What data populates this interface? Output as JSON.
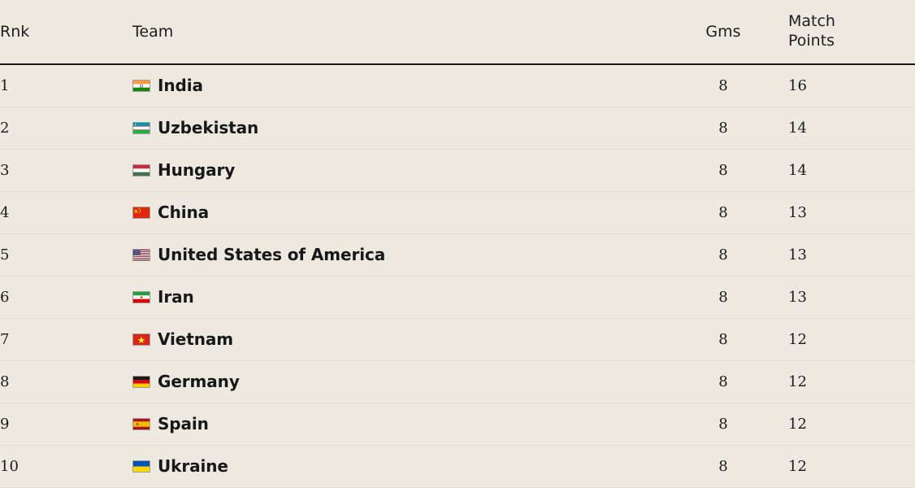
{
  "table": {
    "columns": [
      {
        "key": "rank",
        "label": "Rnk"
      },
      {
        "key": "team",
        "label": "Team"
      },
      {
        "key": "games",
        "label": "Gms"
      },
      {
        "key": "match_points",
        "label": "Match Points"
      }
    ],
    "header": {
      "rnk": "Rnk",
      "team": "Team",
      "gms": "Gms",
      "match_points_line1": "Match",
      "match_points_line2": "Points"
    },
    "rows": [
      {
        "rank": "1",
        "flag": "flag-india",
        "team": "India",
        "games": "8",
        "match_points": "16"
      },
      {
        "rank": "2",
        "flag": "flag-uzbekistan",
        "team": "Uzbekistan",
        "games": "8",
        "match_points": "14"
      },
      {
        "rank": "3",
        "flag": "flag-hungary",
        "team": "Hungary",
        "games": "8",
        "match_points": "14"
      },
      {
        "rank": "4",
        "flag": "flag-china",
        "team": "China",
        "games": "8",
        "match_points": "13"
      },
      {
        "rank": "5",
        "flag": "flag-united-states",
        "team": "United States of America",
        "games": "8",
        "match_points": "13"
      },
      {
        "rank": "6",
        "flag": "flag-iran",
        "team": "Iran",
        "games": "8",
        "match_points": "13"
      },
      {
        "rank": "7",
        "flag": "flag-vietnam",
        "team": "Vietnam",
        "games": "8",
        "match_points": "12"
      },
      {
        "rank": "8",
        "flag": "flag-germany",
        "team": "Germany",
        "games": "8",
        "match_points": "12"
      },
      {
        "rank": "9",
        "flag": "flag-spain",
        "team": "Spain",
        "games": "8",
        "match_points": "12"
      },
      {
        "rank": "10",
        "flag": "flag-ukraine",
        "team": "Ukraine",
        "games": "8",
        "match_points": "12"
      }
    ]
  },
  "colors": {
    "page_background": "#EDE9E0",
    "header_rule": "#17181A",
    "row_divider": "#E2DDD2",
    "text_primary": "#17181A",
    "text_numeric": "#1B1B1B"
  }
}
